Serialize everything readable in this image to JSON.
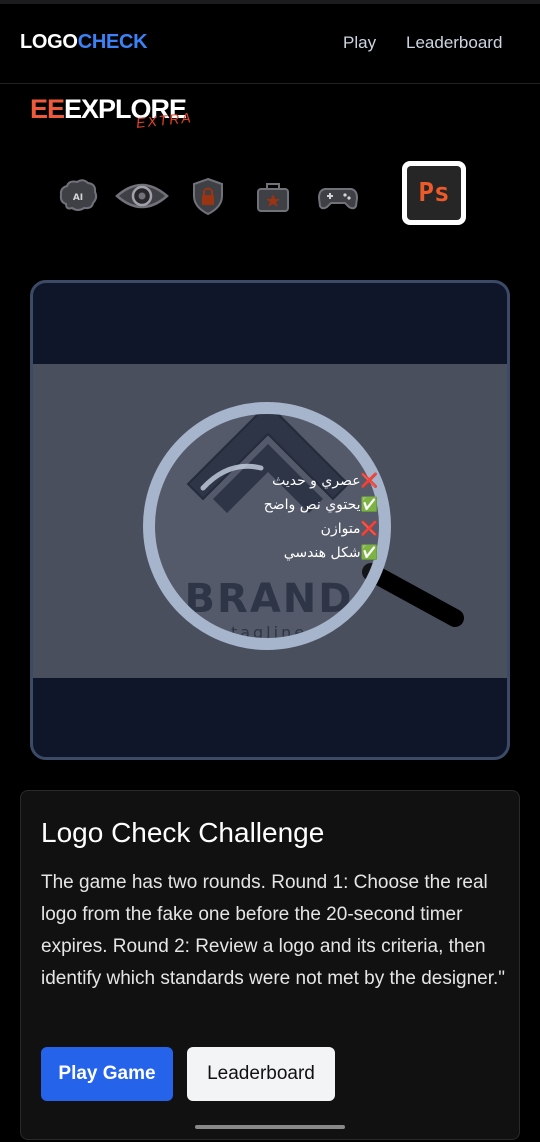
{
  "nav": {
    "logo_white": "LOGO",
    "logo_blue": "CHECK",
    "links": [
      "Play",
      "Leaderboard"
    ]
  },
  "brand": {
    "main_accent": "EE",
    "main_rest": "EXPLORE",
    "sub": "EXTRA"
  },
  "icons": [
    "ai-brain-icon",
    "eye-icon",
    "shield-lock-icon",
    "toolbox-icon",
    "gamepad-icon",
    "photoshop-icon"
  ],
  "ps_label": "Ps",
  "preview": {
    "logo_word": "BRAND",
    "logo_tagline": "tagline",
    "criteria": [
      {
        "text": "عصري و حديث",
        "status": "❌"
      },
      {
        "text": "يحتوي نص واضح",
        "status": "✅"
      },
      {
        "text": "متوازن",
        "status": "❌"
      },
      {
        "text": "شكل هندسي",
        "status": "✅"
      }
    ]
  },
  "card": {
    "title": "Logo Check Challenge",
    "description": "The game has two rounds. Round 1: Choose the real logo from the fake one before the 20-second timer expires. Round 2: Review a logo and its criteria, then identify which standards were not met by the designer.\"",
    "play_label": "Play Game",
    "leaderboard_label": "Leaderboard"
  },
  "colors": {
    "accent_blue": "#3b82f6",
    "button_blue": "#2563eb",
    "brand_orange": "#ef5a3a",
    "frame_bg": "#0f1629"
  }
}
